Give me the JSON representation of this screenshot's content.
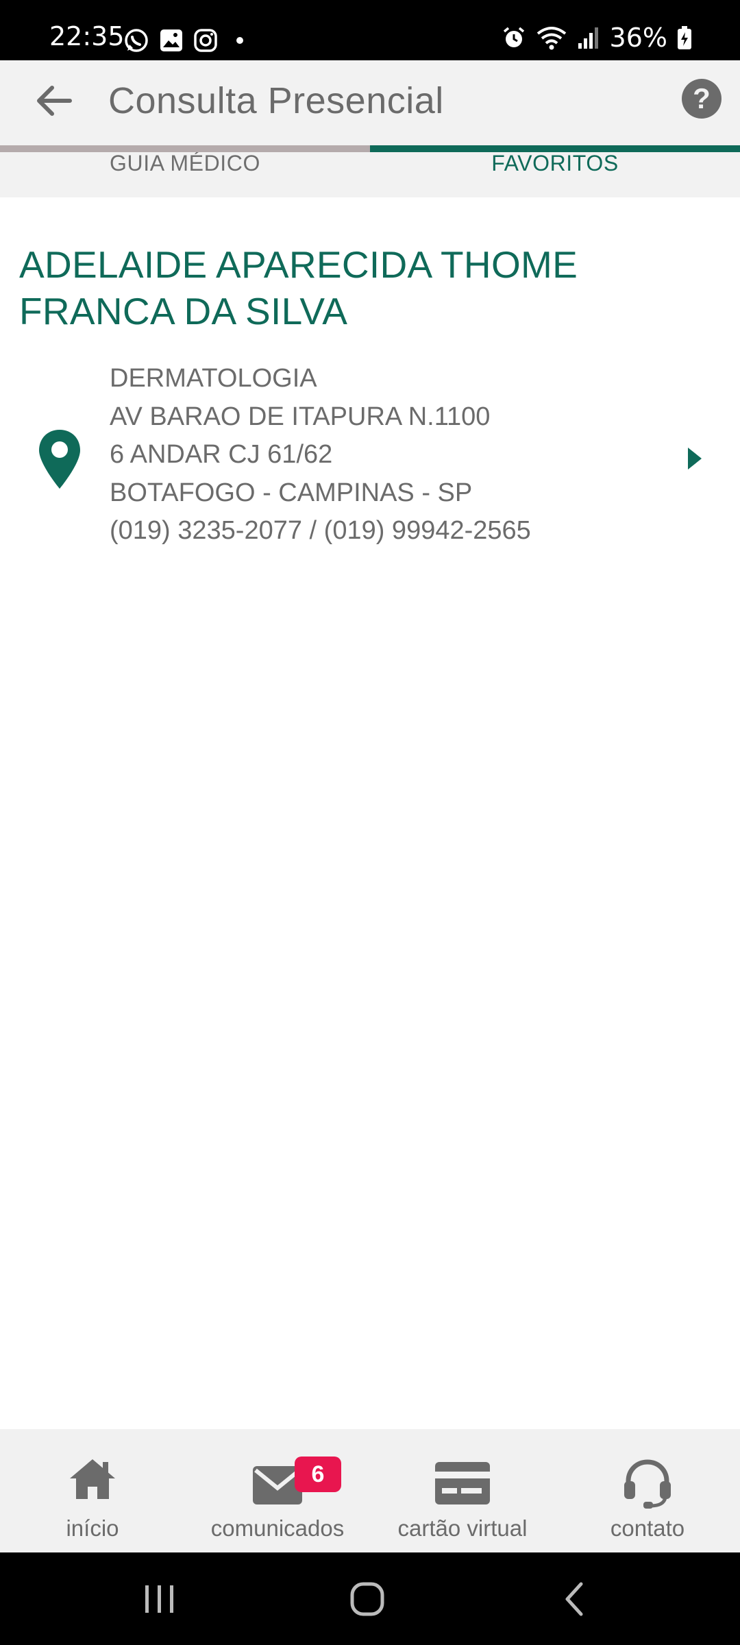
{
  "status_bar": {
    "time": "22:35",
    "battery": "36%",
    "left_icons": [
      "whatsapp-icon",
      "gallery-icon",
      "instagram-icon",
      "dot-icon"
    ],
    "right_icons": [
      "alarm-icon",
      "wifi-icon",
      "signal-icon",
      "battery-icon"
    ]
  },
  "app_bar": {
    "title": "Consulta Presencial",
    "back_icon": "arrow-left-icon",
    "help_icon": "help-icon"
  },
  "tabs": [
    {
      "label": "GUIA MÉDICO",
      "active": false
    },
    {
      "label": "FAVORITOS",
      "active": true
    }
  ],
  "doctor": {
    "name": "ADELAIDE APARECIDA THOME FRANCA DA SILVA",
    "specialty": "DERMATOLOGIA",
    "address_line1": "AV BARAO DE ITAPURA N.1100",
    "address_line2": "6 ANDAR CJ 61/62",
    "city_line": "BOTAFOGO - CAMPINAS - SP",
    "phones": "(019) 3235-2077 / (019) 99942-2565"
  },
  "bottom_nav": [
    {
      "label": "início",
      "icon": "home-icon"
    },
    {
      "label": "comunicados",
      "icon": "mail-icon",
      "badge": "6"
    },
    {
      "label": "cartão virtual",
      "icon": "card-icon"
    },
    {
      "label": "contato",
      "icon": "headset-icon"
    }
  ],
  "colors": {
    "accent": "#0f6a59",
    "badge": "#e8164f",
    "text_gray": "#6b6b6b",
    "app_bar_bg": "#f2f2f2"
  }
}
